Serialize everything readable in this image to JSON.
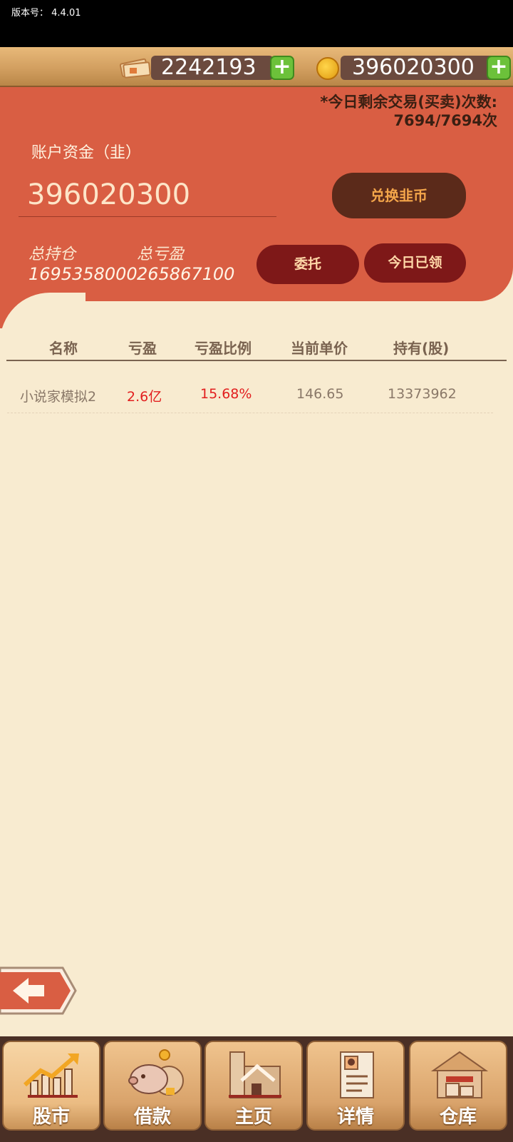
{
  "status": {
    "version": "版本号：  4.4.01"
  },
  "currency": {
    "cash": "2242193",
    "gold": "396020300",
    "plus": "+"
  },
  "trades": {
    "line1": "*今日剩余交易(买卖)次数:",
    "line2": "7694/7694次"
  },
  "account": {
    "label": "账户资金（韭）",
    "value": "396020300",
    "exchange_button": "兑换韭币",
    "total_position_label": "总持仓",
    "total_position_value": "1695358000",
    "total_pnl_label": "总亏盈",
    "total_pnl_value": "265867100",
    "entrust_button": "委托",
    "today_button": "今日已领"
  },
  "table": {
    "headers": [
      "名称",
      "亏盈",
      "亏盈比例",
      "当前单价",
      "持有(股)"
    ],
    "rows": [
      {
        "name": "小说家模拟2",
        "pnl": "2.6亿",
        "pnl_ratio": "15.68%",
        "price": "146.65",
        "shares": "13373962"
      }
    ]
  },
  "tabs": [
    {
      "label": "股市",
      "icon": "chart-up-icon",
      "active": true
    },
    {
      "label": "借款",
      "icon": "piggy-bank-icon",
      "active": false
    },
    {
      "label": "主页",
      "icon": "home-icon",
      "active": false
    },
    {
      "label": "详情",
      "icon": "profile-document-icon",
      "active": false
    },
    {
      "label": "仓库",
      "icon": "warehouse-icon",
      "active": false
    }
  ],
  "colors": {
    "panel": "#d95e43",
    "background": "#f8ebd0",
    "loss_gain": "#e21e1e"
  }
}
